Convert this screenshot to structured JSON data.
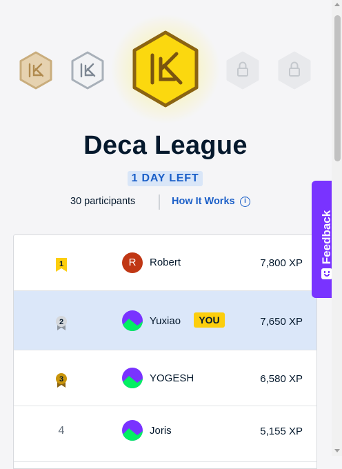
{
  "league": {
    "title": "Deca League",
    "time_left": "1 DAY LEFT",
    "participants": "30 participants",
    "how_it_works": "How It Works"
  },
  "badges": [
    {
      "name": "bronze-league-badge",
      "state": "completed",
      "color": "#e8d2ad"
    },
    {
      "name": "silver-league-badge",
      "state": "completed",
      "color": "#c7cdd4"
    },
    {
      "name": "deca-league-badge",
      "state": "current",
      "color": "#fcd40f"
    },
    {
      "name": "locked-league-badge",
      "state": "locked",
      "icon": "lock-icon"
    },
    {
      "name": "locked-league-badge",
      "state": "locked",
      "icon": "lock-icon"
    }
  ],
  "leaderboard": [
    {
      "rank": "1",
      "medal": "gold",
      "avatar": "R",
      "avatar_color": "#c03714",
      "name": "Robert",
      "xp": "7,800 XP",
      "is_you": false
    },
    {
      "rank": "2",
      "medal": "silver",
      "avatar": "image",
      "name": "Yuxiao",
      "xp": "7,650 XP",
      "is_you": true,
      "you_label": "YOU"
    },
    {
      "rank": "3",
      "medal": "bronze",
      "avatar": "image",
      "name": "YOGESH",
      "xp": "6,580 XP",
      "is_you": false
    },
    {
      "rank": "4",
      "medal": "",
      "avatar": "image",
      "name": "Joris",
      "xp": "5,155 XP",
      "is_you": false
    }
  ],
  "feedback": {
    "label": "Feedback",
    "icon": "smile-icon"
  },
  "colors": {
    "accent": "#1b5fc8",
    "highlight_row": "#dbe7f9",
    "you_tag": "#fcce0d",
    "feedback": "#7933ff"
  }
}
